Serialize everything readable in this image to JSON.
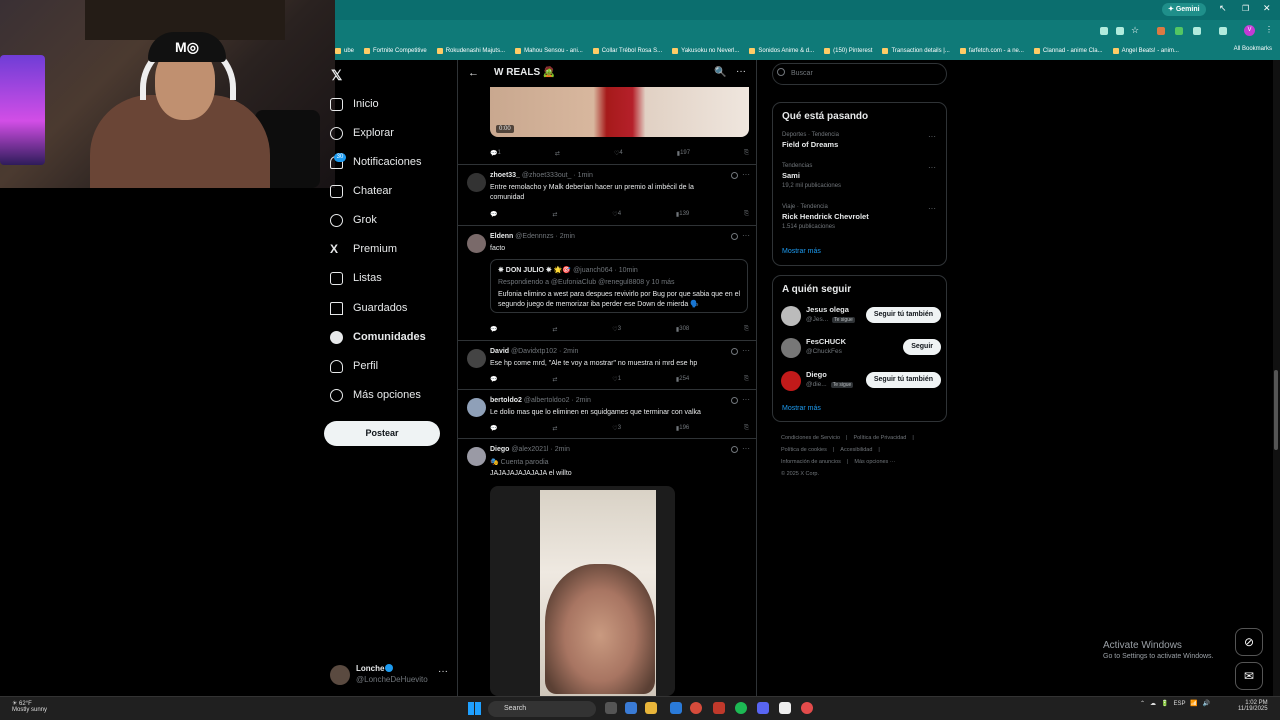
{
  "browser": {
    "gemini_label": "Gemini",
    "bookmarks": [
      "ube",
      "Fortnite Competitive",
      "Rokudenashi Majuts...",
      "Mahou Sensou - ani...",
      "Collar Trébol Rosa S...",
      "Yakusoku no Neverl...",
      "Sonidos Anime & d...",
      "(150) Pinterest",
      "Transaction details |...",
      "farfetch.com - a ne...",
      "Clannad - anime Cla...",
      "Angel Beats! - anim..."
    ],
    "all_bookmarks": "All Bookmarks"
  },
  "webcam": {
    "cap_text": "M◎"
  },
  "nav": {
    "logo": "𝕏",
    "items": [
      {
        "label": "Inicio",
        "icon": "home-icon"
      },
      {
        "label": "Explorar",
        "icon": "search-icon"
      },
      {
        "label": "Notificaciones",
        "icon": "bell-icon",
        "badge": "30"
      },
      {
        "label": "Chatear",
        "icon": "mail-icon"
      },
      {
        "label": "Grok",
        "icon": "grok-icon"
      },
      {
        "label": "Premium",
        "icon": "x-icon"
      },
      {
        "label": "Listas",
        "icon": "list-icon"
      },
      {
        "label": "Guardados",
        "icon": "bookmark-icon"
      },
      {
        "label": "Comunidades",
        "icon": "people-icon"
      },
      {
        "label": "Perfil",
        "icon": "person-icon"
      },
      {
        "label": "Más opciones",
        "icon": "more-circle-icon"
      }
    ],
    "post_label": "Postear",
    "account": {
      "name": "Lonche",
      "handle": "@LoncheDeHuevito",
      "more": "···"
    }
  },
  "timeline": {
    "title": "W REALS 🧟",
    "back": "←",
    "search": "🔍",
    "more": "···",
    "video_time": "0:00",
    "first_actions": {
      "reply": "1",
      "retweet": "",
      "like": "4",
      "views": "197"
    },
    "tweets": [
      {
        "name": "zhoet33_",
        "meta": "@zhoet333out_ · 1min",
        "text": "Entre remolacho y Malk deberían hacer un premio al imbécil de la comunidad",
        "reply": "",
        "retweet": "",
        "like": "4",
        "views": "139"
      },
      {
        "name": "Eldenn",
        "meta": "@Edennnzs · 2min",
        "text": "facto",
        "reply": "",
        "retweet": "",
        "like": "3",
        "views": "308",
        "quote": {
          "name": "✵ DON JULIO ✵ 🌟🎯",
          "meta": "@juanch064 · 10min",
          "reply": "Respondiendo a @EufoniaClub @renegul8808 y 10 más",
          "text": "Eufonia elimino a west para despues revivirlo por Bug por que sabia que en el segundo juego de memorizar iba perder ese Down de mierda 🗣️"
        }
      },
      {
        "name": "David",
        "meta": "@Davidxtp102 · 2min",
        "text": "Ese hp come mrd, \"Ale te voy a mostrar\" no muestra ni mrd ese hp",
        "reply": "",
        "retweet": "",
        "like": "1",
        "views": "254"
      },
      {
        "name": "bertoldo2",
        "meta": "@albertoldoo2 · 2min",
        "text": "Le dolio mas que lo eliminen en squidgames que terminar con valka",
        "reply": "",
        "retweet": "",
        "like": "3",
        "views": "196"
      },
      {
        "name": "Diego",
        "meta": "@alex2021l · 2min",
        "parody": "🎭 Cuenta parodia",
        "text": "JAJAJAJAJAJAJA el willto"
      }
    ]
  },
  "right": {
    "search_placeholder": "Buscar",
    "trends_title": "Qué está pasando",
    "trends": [
      {
        "context": "Deportes · Tendencia",
        "name": "Field of Dreams",
        "count": ""
      },
      {
        "context": "Tendencias",
        "name": "Sami",
        "count": "19,2 mil publicaciones"
      },
      {
        "context": "Viaje · Tendencia",
        "name": "Rick Hendrick Chevrolet",
        "count": "1.514 publicaciones"
      }
    ],
    "trends_more": "Mostrar más",
    "follow_title": "A quién seguir",
    "follow": [
      {
        "name": "Jesus olega",
        "handle": "@Jes...",
        "badge": "Te sigue",
        "button": "Seguir tú también"
      },
      {
        "name": "FesCHUCK",
        "handle": "@ChuckFes",
        "badge": "",
        "button": "Seguir"
      },
      {
        "name": "Diego",
        "handle": "@die...",
        "badge": "Te sigue",
        "button": "Seguir tú también"
      }
    ],
    "follow_more": "Mostrar más",
    "footer": [
      "Condiciones de Servicio",
      "|",
      "Política de Privacidad",
      "|",
      "Política de cookies",
      "|",
      "Accesibilidad",
      "|",
      "Información de anuncios",
      "|",
      "Más opciones ···",
      "© 2025 X Corp."
    ]
  },
  "windows": {
    "activate_title": "Activate Windows",
    "activate_sub": "Go to Settings to activate Windows.",
    "weather_temp": "62°F",
    "weather_desc": "Mostly sunny",
    "search": "Search",
    "lang": "ESP",
    "time": "1:02 PM",
    "date": "11/19/2025"
  },
  "colors": {
    "accent": "#1d9bf0",
    "chrome": "#0f7a78"
  }
}
